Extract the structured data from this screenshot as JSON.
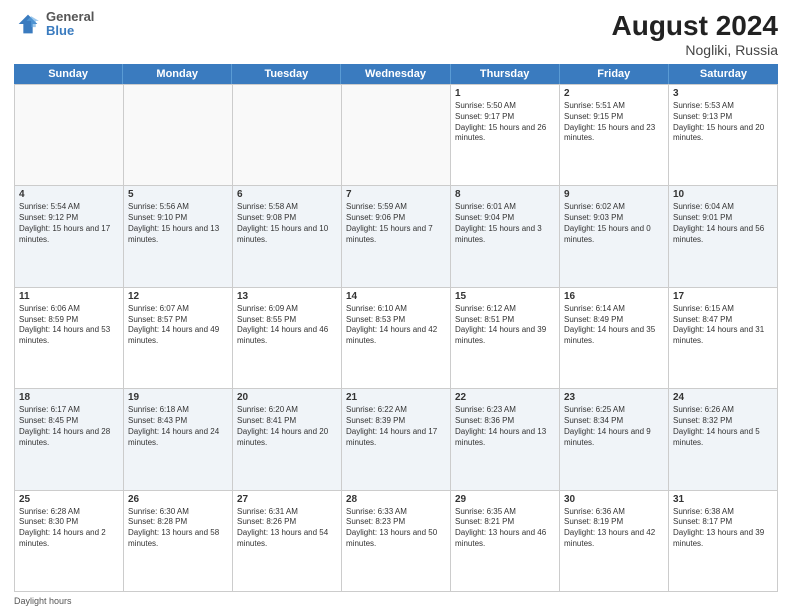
{
  "header": {
    "logo_general": "General",
    "logo_blue": "Blue",
    "title": "August 2024",
    "subtitle": "Nogliki, Russia"
  },
  "days": [
    "Sunday",
    "Monday",
    "Tuesday",
    "Wednesday",
    "Thursday",
    "Friday",
    "Saturday"
  ],
  "weeks": [
    [
      {
        "day": "",
        "info": "",
        "empty": true
      },
      {
        "day": "",
        "info": "",
        "empty": true
      },
      {
        "day": "",
        "info": "",
        "empty": true
      },
      {
        "day": "",
        "info": "",
        "empty": true
      },
      {
        "day": "1",
        "info": "Sunrise: 5:50 AM\nSunset: 9:17 PM\nDaylight: 15 hours and 26 minutes."
      },
      {
        "day": "2",
        "info": "Sunrise: 5:51 AM\nSunset: 9:15 PM\nDaylight: 15 hours and 23 minutes."
      },
      {
        "day": "3",
        "info": "Sunrise: 5:53 AM\nSunset: 9:13 PM\nDaylight: 15 hours and 20 minutes."
      }
    ],
    [
      {
        "day": "4",
        "info": "Sunrise: 5:54 AM\nSunset: 9:12 PM\nDaylight: 15 hours and 17 minutes."
      },
      {
        "day": "5",
        "info": "Sunrise: 5:56 AM\nSunset: 9:10 PM\nDaylight: 15 hours and 13 minutes."
      },
      {
        "day": "6",
        "info": "Sunrise: 5:58 AM\nSunset: 9:08 PM\nDaylight: 15 hours and 10 minutes."
      },
      {
        "day": "7",
        "info": "Sunrise: 5:59 AM\nSunset: 9:06 PM\nDaylight: 15 hours and 7 minutes."
      },
      {
        "day": "8",
        "info": "Sunrise: 6:01 AM\nSunset: 9:04 PM\nDaylight: 15 hours and 3 minutes."
      },
      {
        "day": "9",
        "info": "Sunrise: 6:02 AM\nSunset: 9:03 PM\nDaylight: 15 hours and 0 minutes."
      },
      {
        "day": "10",
        "info": "Sunrise: 6:04 AM\nSunset: 9:01 PM\nDaylight: 14 hours and 56 minutes."
      }
    ],
    [
      {
        "day": "11",
        "info": "Sunrise: 6:06 AM\nSunset: 8:59 PM\nDaylight: 14 hours and 53 minutes."
      },
      {
        "day": "12",
        "info": "Sunrise: 6:07 AM\nSunset: 8:57 PM\nDaylight: 14 hours and 49 minutes."
      },
      {
        "day": "13",
        "info": "Sunrise: 6:09 AM\nSunset: 8:55 PM\nDaylight: 14 hours and 46 minutes."
      },
      {
        "day": "14",
        "info": "Sunrise: 6:10 AM\nSunset: 8:53 PM\nDaylight: 14 hours and 42 minutes."
      },
      {
        "day": "15",
        "info": "Sunrise: 6:12 AM\nSunset: 8:51 PM\nDaylight: 14 hours and 39 minutes."
      },
      {
        "day": "16",
        "info": "Sunrise: 6:14 AM\nSunset: 8:49 PM\nDaylight: 14 hours and 35 minutes."
      },
      {
        "day": "17",
        "info": "Sunrise: 6:15 AM\nSunset: 8:47 PM\nDaylight: 14 hours and 31 minutes."
      }
    ],
    [
      {
        "day": "18",
        "info": "Sunrise: 6:17 AM\nSunset: 8:45 PM\nDaylight: 14 hours and 28 minutes."
      },
      {
        "day": "19",
        "info": "Sunrise: 6:18 AM\nSunset: 8:43 PM\nDaylight: 14 hours and 24 minutes."
      },
      {
        "day": "20",
        "info": "Sunrise: 6:20 AM\nSunset: 8:41 PM\nDaylight: 14 hours and 20 minutes."
      },
      {
        "day": "21",
        "info": "Sunrise: 6:22 AM\nSunset: 8:39 PM\nDaylight: 14 hours and 17 minutes."
      },
      {
        "day": "22",
        "info": "Sunrise: 6:23 AM\nSunset: 8:36 PM\nDaylight: 14 hours and 13 minutes."
      },
      {
        "day": "23",
        "info": "Sunrise: 6:25 AM\nSunset: 8:34 PM\nDaylight: 14 hours and 9 minutes."
      },
      {
        "day": "24",
        "info": "Sunrise: 6:26 AM\nSunset: 8:32 PM\nDaylight: 14 hours and 5 minutes."
      }
    ],
    [
      {
        "day": "25",
        "info": "Sunrise: 6:28 AM\nSunset: 8:30 PM\nDaylight: 14 hours and 2 minutes."
      },
      {
        "day": "26",
        "info": "Sunrise: 6:30 AM\nSunset: 8:28 PM\nDaylight: 13 hours and 58 minutes."
      },
      {
        "day": "27",
        "info": "Sunrise: 6:31 AM\nSunset: 8:26 PM\nDaylight: 13 hours and 54 minutes."
      },
      {
        "day": "28",
        "info": "Sunrise: 6:33 AM\nSunset: 8:23 PM\nDaylight: 13 hours and 50 minutes."
      },
      {
        "day": "29",
        "info": "Sunrise: 6:35 AM\nSunset: 8:21 PM\nDaylight: 13 hours and 46 minutes."
      },
      {
        "day": "30",
        "info": "Sunrise: 6:36 AM\nSunset: 8:19 PM\nDaylight: 13 hours and 42 minutes."
      },
      {
        "day": "31",
        "info": "Sunrise: 6:38 AM\nSunset: 8:17 PM\nDaylight: 13 hours and 39 minutes."
      }
    ]
  ],
  "footer": "Daylight hours"
}
